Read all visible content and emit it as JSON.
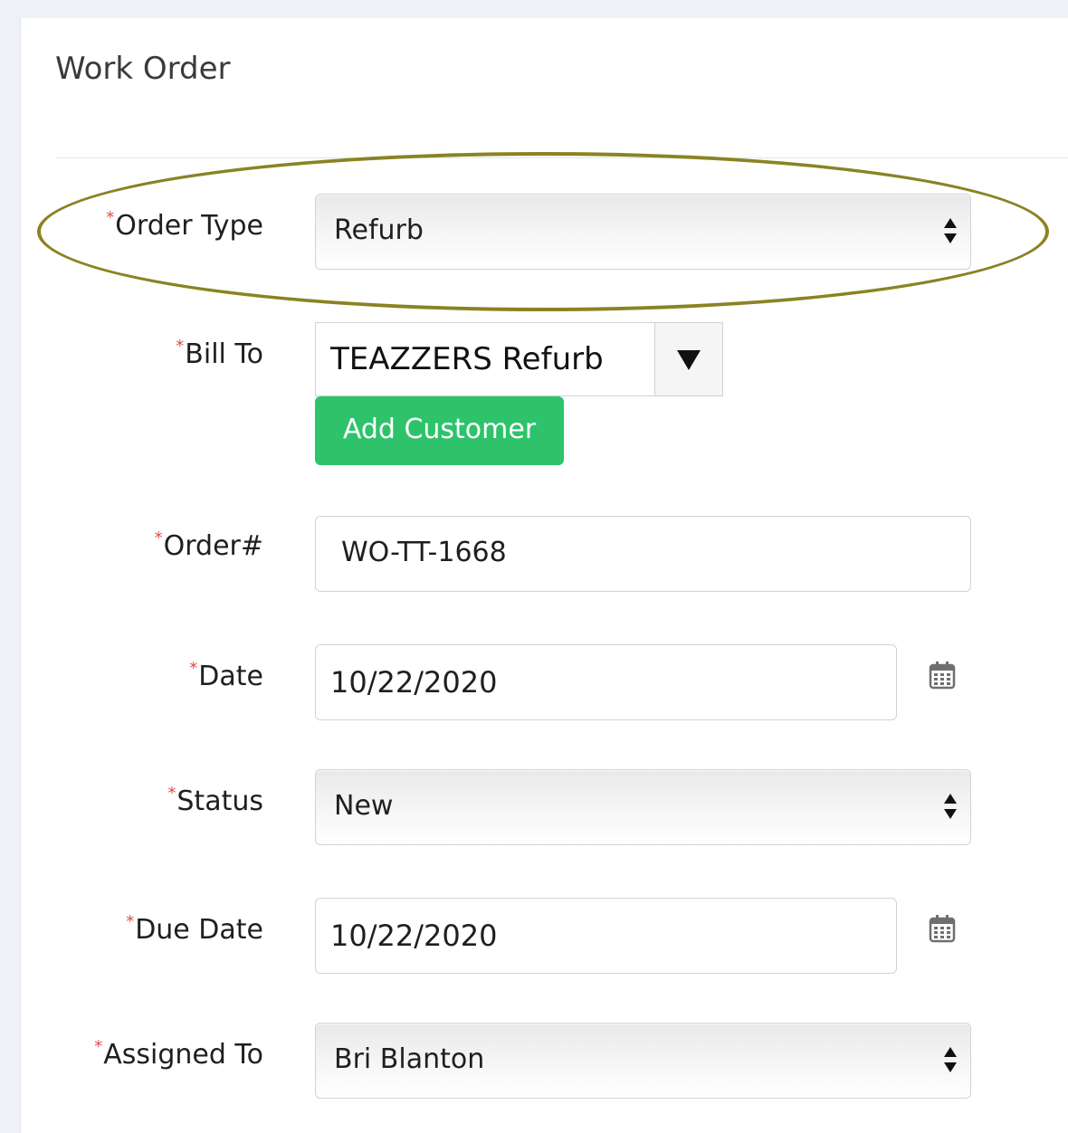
{
  "form": {
    "title": "Work Order",
    "fields": {
      "order_type": {
        "label": "Order Type",
        "value": "Refurb"
      },
      "bill_to": {
        "label": "Bill To",
        "value": "TEAZZERS Refurb",
        "add_button": "Add Customer"
      },
      "order_number": {
        "label": "Order#",
        "value": "WO-TT-1668"
      },
      "date": {
        "label": "Date",
        "value": "10/22/2020"
      },
      "status": {
        "label": "Status",
        "value": "New"
      },
      "due_date": {
        "label": "Due Date",
        "value": "10/22/2020"
      },
      "assigned_to": {
        "label": "Assigned To",
        "value": "Bri Blanton"
      }
    },
    "required_marker": "*"
  },
  "colors": {
    "accent_green": "#2ec36b",
    "required": "#e34b4b",
    "highlight_ellipse": "#8a8323"
  },
  "icons": {
    "select_arrows": "up-down-arrows-icon",
    "dropdown": "caret-down-icon",
    "calendar": "calendar-icon"
  }
}
